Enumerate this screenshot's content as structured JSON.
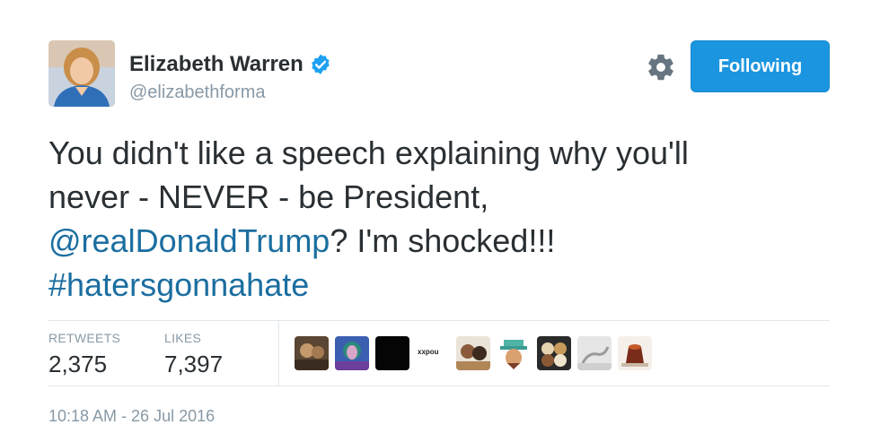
{
  "author": {
    "name": "Elizabeth Warren",
    "handle": "@elizabethforma",
    "verified": true,
    "avatar_icon": "profile-photo"
  },
  "actions": {
    "follow_label": "Following",
    "settings_icon": "gear-icon"
  },
  "tweet": {
    "line1": "You didn't like a speech explaining why you'll",
    "line2": "never - NEVER - be President,",
    "mention": "@realDonaldTrump",
    "line3_rest": "? I'm shocked!!!",
    "hashtag": "#hatersgonnahate"
  },
  "stats": {
    "retweets_label": "RETWEETS",
    "retweets_value": "2,375",
    "likes_label": "LIKES",
    "likes_value": "7,397"
  },
  "likers": [
    {
      "icon": "liker-avatar-1"
    },
    {
      "icon": "liker-avatar-2"
    },
    {
      "icon": "liker-avatar-3"
    },
    {
      "icon": "liker-avatar-4",
      "text": "xxpou"
    },
    {
      "icon": "liker-avatar-5"
    },
    {
      "icon": "liker-avatar-6"
    },
    {
      "icon": "liker-avatar-7"
    },
    {
      "icon": "liker-avatar-8"
    },
    {
      "icon": "liker-avatar-9"
    }
  ],
  "timestamp": "10:18 AM - 26 Jul 2016",
  "colors": {
    "link": "#1b6ea0",
    "button": "#1b95e0",
    "muted": "#8899a6",
    "verified": "#1da1f2"
  }
}
